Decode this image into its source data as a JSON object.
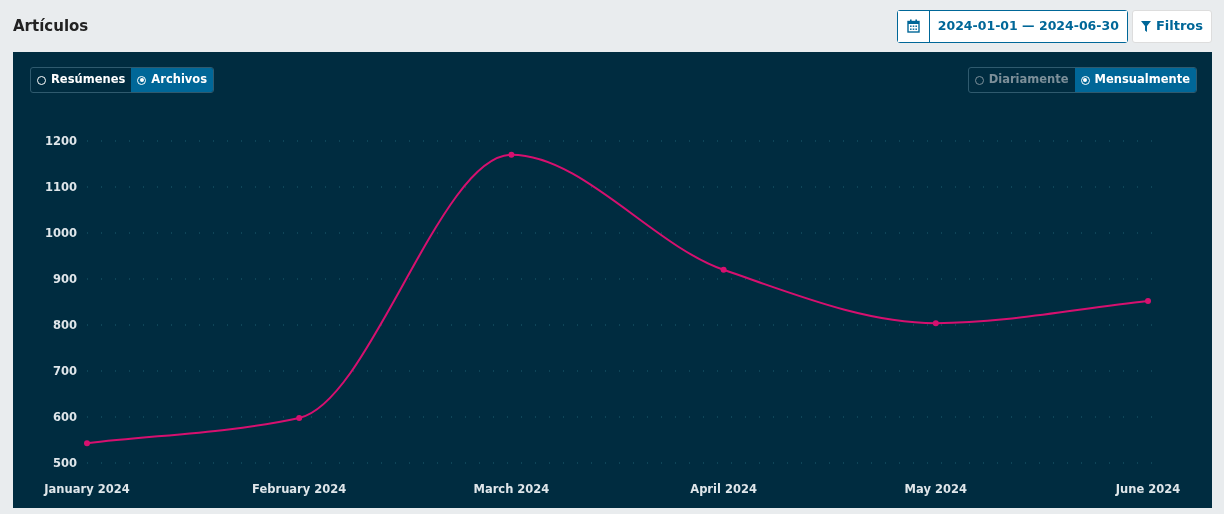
{
  "title": "Artículos",
  "date_range": "2024-01-01 — 2024-06-30",
  "filters_button": "Filtros",
  "type_toggle": [
    {
      "label": "Resúmenes",
      "selected": false
    },
    {
      "label": "Archivos",
      "selected": true
    }
  ],
  "interval_toggle": [
    {
      "label": "Diariamente",
      "selected": false
    },
    {
      "label": "Mensualmente",
      "selected": true
    }
  ],
  "chart": {
    "chart_data": {
      "type": "line",
      "categories": [
        "January 2024",
        "February 2024",
        "March 2024",
        "April 2024",
        "May 2024",
        "June 2024"
      ],
      "values": [
        543,
        598,
        1170,
        920,
        804,
        852
      ],
      "ylim": [
        500,
        1200
      ],
      "yticks": [
        500,
        600,
        700,
        800,
        900,
        1000,
        1100,
        1200
      ],
      "grid": true,
      "marker": true
    }
  }
}
